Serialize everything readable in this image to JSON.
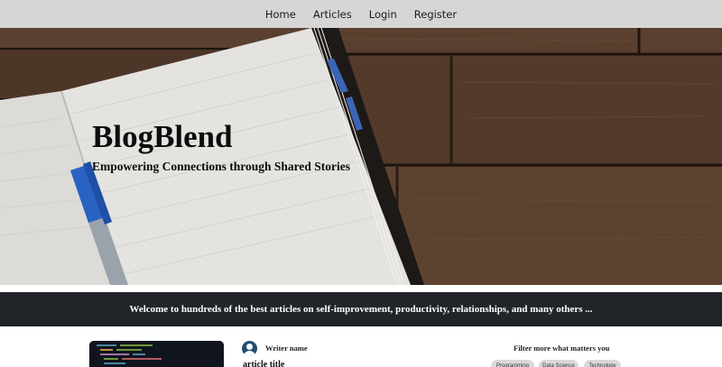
{
  "nav": {
    "items": [
      "Home",
      "Articles",
      "Login",
      "Register"
    ]
  },
  "hero": {
    "title": "BlogBlend",
    "subtitle": "Empowering Connections through Shared Stories"
  },
  "banner": {
    "text": "Welcome to hundreds of the best articles on self-improvement, productivity, relationships, and many others ..."
  },
  "article": {
    "writer_name": "Writer name",
    "title": "article title"
  },
  "filter": {
    "heading": "Filter more what matters you",
    "tags": [
      "Programming",
      "Data Science",
      "Technology"
    ]
  },
  "colors": {
    "nav_bg": "#d6d6d6",
    "banner_bg": "#212529",
    "avatar": "#1f4e75",
    "chip_bg": "#d9d9d9"
  }
}
